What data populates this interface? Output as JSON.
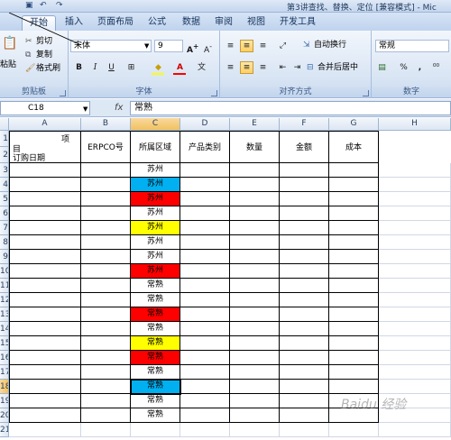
{
  "window": {
    "title": "第3讲查找、替换、定位 [兼容模式] - Mic"
  },
  "tabs": [
    "开始",
    "插入",
    "页面布局",
    "公式",
    "数据",
    "审阅",
    "视图",
    "开发工具"
  ],
  "ribbon": {
    "clipboard": {
      "label": "剪贴板",
      "paste": "粘贴",
      "cut": "剪切",
      "copy": "复制",
      "format_painter": "格式刷"
    },
    "font": {
      "label": "字体",
      "name": "宋体",
      "size": "9",
      "bold": "B",
      "italic": "I",
      "underline": "U",
      "wen": "文"
    },
    "alignment": {
      "label": "对齐方式",
      "wrap_text": "自动换行",
      "merge_center": "合并后居中"
    },
    "number": {
      "label": "数字",
      "format": "常规",
      "percent": "%",
      "comma": ","
    }
  },
  "formula_bar": {
    "name_box": "C18",
    "fx": "fx",
    "content": "常熟"
  },
  "columns": [
    "A",
    "B",
    "C",
    "D",
    "E",
    "F",
    "G",
    "H"
  ],
  "rows": [
    "1",
    "2",
    "3",
    "4",
    "5",
    "6",
    "7",
    "8",
    "9",
    "10",
    "11",
    "12",
    "13",
    "14",
    "15",
    "16",
    "17",
    "18",
    "19",
    "20",
    "21"
  ],
  "table": {
    "diag_top": "项",
    "diag_mid": "目",
    "diag_bottom": "订购日期",
    "headers": [
      "ERPCO号",
      "所属区域",
      "产品类别",
      "数量",
      "金额",
      "成本"
    ],
    "region_values": [
      {
        "text": "苏州",
        "color": "#ffffff"
      },
      {
        "text": "苏州",
        "color": "#00b0f0"
      },
      {
        "text": "苏州",
        "color": "#ff0000"
      },
      {
        "text": "苏州",
        "color": "#ffffff"
      },
      {
        "text": "苏州",
        "color": "#ffff00"
      },
      {
        "text": "苏州",
        "color": "#ffffff"
      },
      {
        "text": "苏州",
        "color": "#ffffff"
      },
      {
        "text": "苏州",
        "color": "#ff0000"
      },
      {
        "text": "常熟",
        "color": "#ffffff"
      },
      {
        "text": "常熟",
        "color": "#ffffff"
      },
      {
        "text": "常熟",
        "color": "#ff0000"
      },
      {
        "text": "常熟",
        "color": "#ffffff"
      },
      {
        "text": "常熟",
        "color": "#ffff00"
      },
      {
        "text": "常熟",
        "color": "#ff0000"
      },
      {
        "text": "常熟",
        "color": "#ffffff"
      },
      {
        "text": "常熟",
        "color": "#00b0f0"
      },
      {
        "text": "常熟",
        "color": "#ffffff"
      },
      {
        "text": "常熟",
        "color": "#ffffff"
      }
    ]
  },
  "watermark": "Baidu 经验"
}
